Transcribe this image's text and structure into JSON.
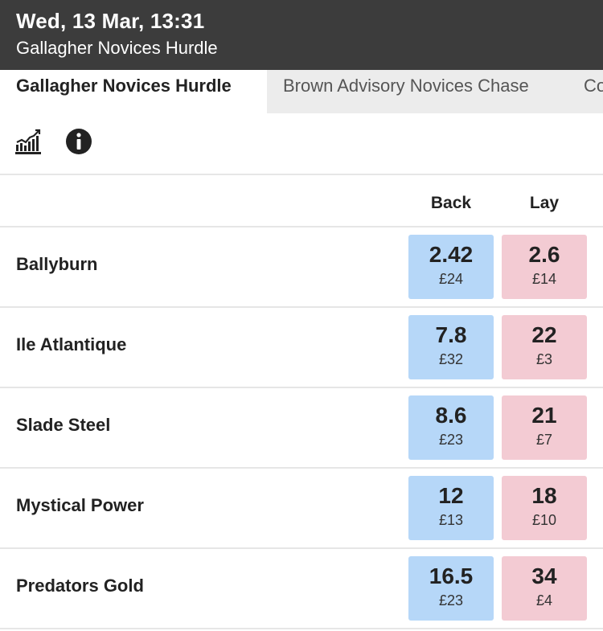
{
  "header": {
    "title": "Wed, 13 Mar, 13:31",
    "subtitle": "Gallagher Novices Hurdle"
  },
  "tabs": [
    {
      "label": "Gallagher Novices Hurdle",
      "active": true
    },
    {
      "label": "Brown Advisory Novices Chase",
      "active": false
    },
    {
      "label": "Co",
      "active": false
    }
  ],
  "toolbar": {
    "icons": [
      "chart-icon",
      "info-icon"
    ]
  },
  "columns": {
    "back": "Back",
    "lay": "Lay"
  },
  "colors": {
    "header_bg": "#3c3c3c",
    "back_bg": "#b6d7f8",
    "lay_bg": "#f3cbd3"
  },
  "runners": [
    {
      "name": "Ballyburn",
      "back_odds": "2.42",
      "back_stake": "£24",
      "lay_odds": "2.6",
      "lay_stake": "£14"
    },
    {
      "name": "Ile Atlantique",
      "back_odds": "7.8",
      "back_stake": "£32",
      "lay_odds": "22",
      "lay_stake": "£3"
    },
    {
      "name": "Slade Steel",
      "back_odds": "8.6",
      "back_stake": "£23",
      "lay_odds": "21",
      "lay_stake": "£7"
    },
    {
      "name": "Mystical Power",
      "back_odds": "12",
      "back_stake": "£13",
      "lay_odds": "18",
      "lay_stake": "£10"
    },
    {
      "name": "Predators Gold",
      "back_odds": "16.5",
      "back_stake": "£23",
      "lay_odds": "34",
      "lay_stake": "£4"
    }
  ]
}
